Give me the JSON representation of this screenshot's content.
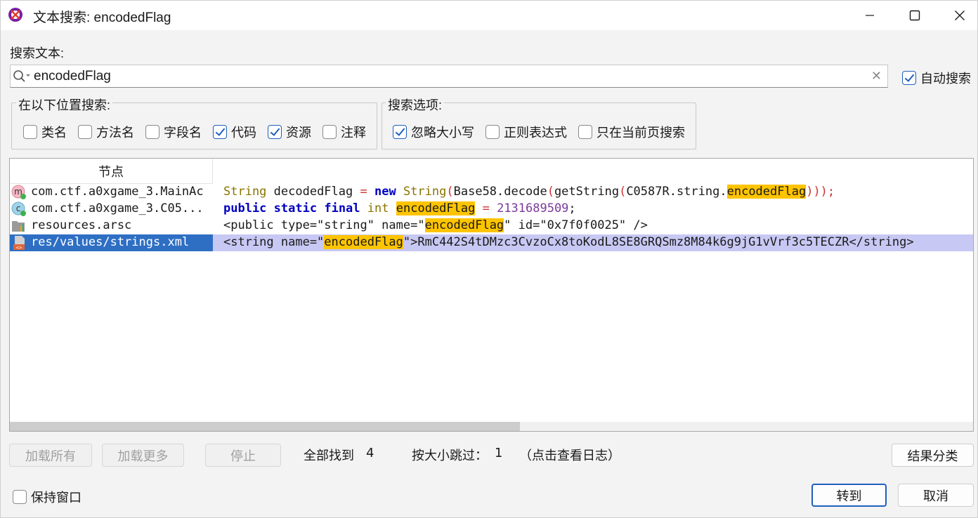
{
  "window": {
    "title": "文本搜索: encodedFlag",
    "app_icon": "jadx-logo-icon"
  },
  "search": {
    "label": "搜索文本:",
    "value": "encodedFlag",
    "auto_search_label": "自动搜索",
    "auto_search_checked": true
  },
  "search_in": {
    "title": "在以下位置搜索:",
    "options": [
      {
        "label": "类名",
        "checked": false
      },
      {
        "label": "方法名",
        "checked": false
      },
      {
        "label": "字段名",
        "checked": false
      },
      {
        "label": "代码",
        "checked": true
      },
      {
        "label": "资源",
        "checked": true
      },
      {
        "label": "注释",
        "checked": false
      }
    ]
  },
  "search_options": {
    "title": "搜索选项:",
    "options": [
      {
        "label": "忽略大小写",
        "checked": true
      },
      {
        "label": "正则表达式",
        "checked": false
      },
      {
        "label": "只在当前页搜索",
        "checked": false
      }
    ]
  },
  "table": {
    "node_header": "节点",
    "rows": [
      {
        "node": "com.ctf.a0xgame_3.MainAc",
        "icon": "method-icon",
        "selected": false,
        "code": {
          "t1": "String",
          "t2": " decodedFlag ",
          "t3": "=",
          "t4": " ",
          "t5": "new",
          "t6": " ",
          "t7": "String",
          "t8": "(",
          "t9": "Base58.decode",
          "t10": "(",
          "t11": "getString",
          "t12": "(",
          "t13": "C0587R.string.",
          "t14": "encodedFlag",
          "t15": ")));"
        }
      },
      {
        "node": "com.ctf.a0xgame_3.C05...",
        "icon": "class-icon",
        "selected": false,
        "code": {
          "t1": "public",
          "t2": " ",
          "t3": "static",
          "t4": " ",
          "t5": "final",
          "t6": " ",
          "t7": "int",
          "t8": " ",
          "t9": "encodedFlag",
          "t10": " = ",
          "t11": "2131689509",
          "t12": ";"
        }
      },
      {
        "node": "resources.arsc",
        "icon": "folder-icon",
        "selected": false,
        "code": {
          "t1": "<public type=\"string\" name=\"",
          "t2": "encodedFlag",
          "t3": "\" id=\"0x7f0f0025\" />"
        }
      },
      {
        "node": "res/values/strings.xml",
        "icon": "xml-file-icon",
        "selected": true,
        "code": {
          "t1": "<string name=\"",
          "t2": "encodedFlag",
          "t3": "\">RmC442S4tDMzc3CvzoCx8toKodL8SE8GRQSmz8M84k6g9jG1vVrf3c5TECZR</string>"
        }
      }
    ]
  },
  "bottom": {
    "load_all": "加载所有",
    "load_more": "加载更多",
    "stop": "停止",
    "found_label": "全部找到",
    "found_count": "4",
    "skipped_label": "按大小跳过：",
    "skipped_count": "1",
    "log_hint": "（点击查看日志）",
    "group_results": "结果分类",
    "keep_window": "保持窗口",
    "keep_window_checked": false,
    "goto": "转到",
    "cancel": "取消"
  }
}
